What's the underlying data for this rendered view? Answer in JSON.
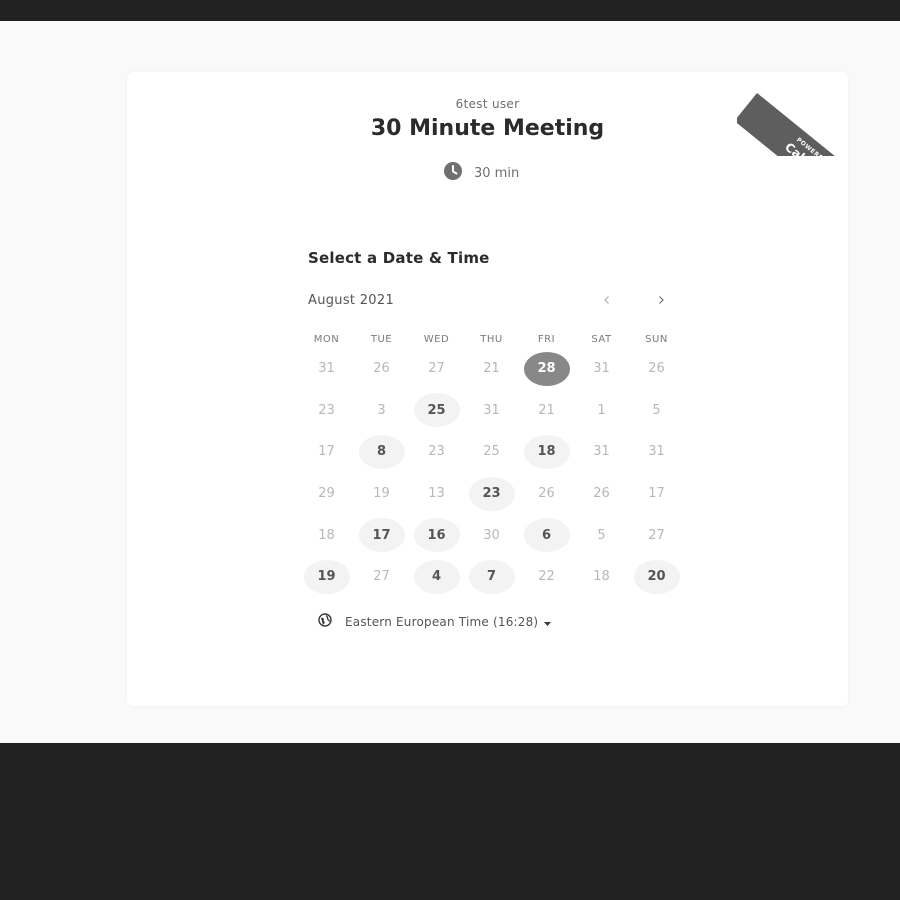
{
  "header": {
    "user_name": "6test user",
    "event_title": "30 Minute Meeting",
    "duration": "30 min"
  },
  "badge": {
    "powered_by": "POWERED BY",
    "brand": "Calendly"
  },
  "calendar": {
    "heading": "Select a Date & Time",
    "month": "August 2021",
    "weekdays": [
      "MON",
      "TUE",
      "WED",
      "THU",
      "FRI",
      "SAT",
      "SUN"
    ],
    "weeks": [
      [
        {
          "d": "31"
        },
        {
          "d": "26"
        },
        {
          "d": "27"
        },
        {
          "d": "21"
        },
        {
          "d": "28",
          "s": "selected"
        },
        {
          "d": "31"
        },
        {
          "d": "26"
        }
      ],
      [
        {
          "d": "23"
        },
        {
          "d": "3"
        },
        {
          "d": "25",
          "s": "available"
        },
        {
          "d": "31"
        },
        {
          "d": "21"
        },
        {
          "d": "1"
        },
        {
          "d": "5"
        }
      ],
      [
        {
          "d": "17"
        },
        {
          "d": "8",
          "s": "available"
        },
        {
          "d": "23"
        },
        {
          "d": "25"
        },
        {
          "d": "18",
          "s": "available"
        },
        {
          "d": "31"
        },
        {
          "d": "31"
        }
      ],
      [
        {
          "d": "29"
        },
        {
          "d": "19"
        },
        {
          "d": "13"
        },
        {
          "d": "23",
          "s": "available"
        },
        {
          "d": "26"
        },
        {
          "d": "26"
        },
        {
          "d": "17"
        }
      ],
      [
        {
          "d": "18"
        },
        {
          "d": "17",
          "s": "available"
        },
        {
          "d": "16",
          "s": "available"
        },
        {
          "d": "30"
        },
        {
          "d": "6",
          "s": "available"
        },
        {
          "d": "5"
        },
        {
          "d": "27"
        }
      ],
      [
        {
          "d": "19",
          "s": "available"
        },
        {
          "d": "27"
        },
        {
          "d": "4",
          "s": "available"
        },
        {
          "d": "7",
          "s": "available"
        },
        {
          "d": "22"
        },
        {
          "d": "18"
        },
        {
          "d": "20",
          "s": "available"
        }
      ]
    ]
  },
  "timezone": {
    "label": "Eastern European Time (16:28)"
  },
  "colors": {
    "page_bg": "#f9f9f9",
    "frame_bg": "#222222",
    "selected_day": "#888888",
    "available_day_bg": "#f3f3f3",
    "ribbon": "#5e5e5e"
  }
}
